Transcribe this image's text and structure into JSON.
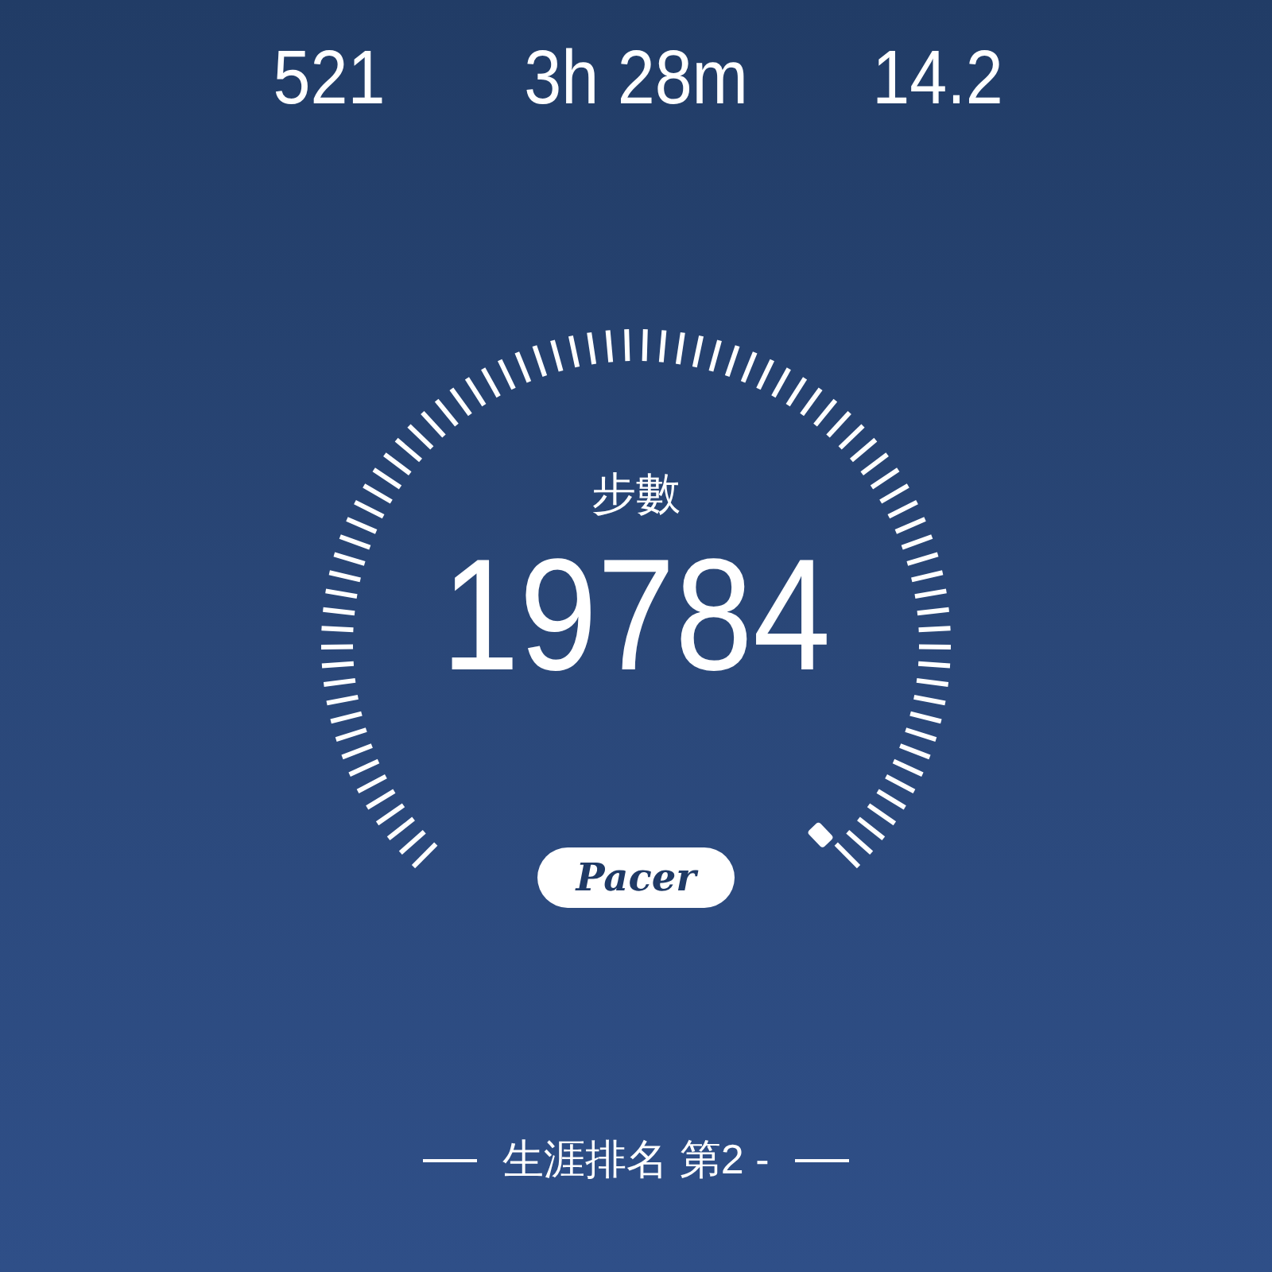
{
  "stats": [
    {
      "value": "521"
    },
    {
      "value": "3h 28m"
    },
    {
      "value": "14.2"
    }
  ],
  "gauge": {
    "label": "步數",
    "value": "19784"
  },
  "logo": {
    "text": "Pacer"
  },
  "ranking": {
    "text": "生涯排名 第2 -"
  }
}
